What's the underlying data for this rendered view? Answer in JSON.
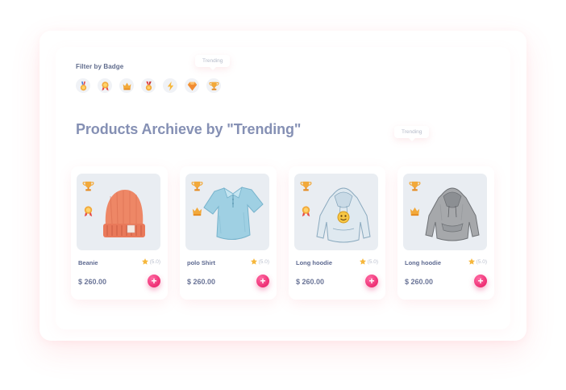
{
  "filter": {
    "label": "Filter by Badge",
    "tooltip": "Trending",
    "badges": [
      {
        "icon": "medal-icon"
      },
      {
        "icon": "ribbon-award-icon"
      },
      {
        "icon": "crown-icon"
      },
      {
        "icon": "red-medal-icon"
      },
      {
        "icon": "lightning-icon"
      },
      {
        "icon": "diamond-icon"
      },
      {
        "icon": "trophy-icon"
      }
    ]
  },
  "heading": "Products Archieve by \"Trending\"",
  "card_tooltip": "Trending",
  "products": [
    {
      "name": "Beanie",
      "rating": "(5.0)",
      "price": "$ 260.00",
      "add_label": "+",
      "badge_icons": [
        "trophy-icon",
        "ribbon-award-icon"
      ],
      "image": "beanie"
    },
    {
      "name": "polo Shirt",
      "rating": "(5.0)",
      "price": "$ 260.00",
      "add_label": "+",
      "badge_icons": [
        "trophy-icon",
        "crown-icon"
      ],
      "image": "polo-shirt"
    },
    {
      "name": "Long hoodie",
      "rating": "(5.0)",
      "price": "$ 260.00",
      "add_label": "+",
      "badge_icons": [
        "trophy-icon",
        "ribbon-award-icon"
      ],
      "image": "blue-hoodie"
    },
    {
      "name": "Long hoodie",
      "rating": "(5.0)",
      "price": "$ 260.00",
      "add_label": "+",
      "badge_icons": [
        "trophy-icon",
        "crown-icon"
      ],
      "image": "gray-hoodie"
    }
  ],
  "colors": {
    "accent": "#e6155f",
    "title": "#8590b4",
    "star": "#f6b73c",
    "card_bg": "#e9edf2"
  }
}
